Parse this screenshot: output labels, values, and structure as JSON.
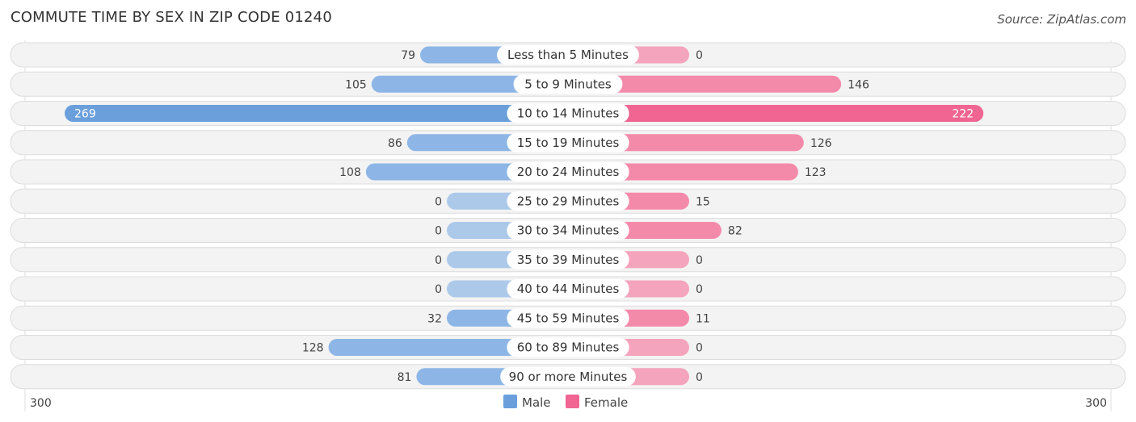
{
  "header": {
    "title": "COMMUTE TIME BY SEX IN ZIP CODE 01240",
    "source": "Source: ZipAtlas.com"
  },
  "chart_data": {
    "type": "bar",
    "orientation": "horizontal-diverging",
    "title": "COMMUTE TIME BY SEX IN ZIP CODE 01240",
    "categories": [
      "Less than 5 Minutes",
      "5 to 9 Minutes",
      "10 to 14 Minutes",
      "15 to 19 Minutes",
      "20 to 24 Minutes",
      "25 to 29 Minutes",
      "30 to 34 Minutes",
      "35 to 39 Minutes",
      "40 to 44 Minutes",
      "45 to 59 Minutes",
      "60 to 89 Minutes",
      "90 or more Minutes"
    ],
    "series": [
      {
        "name": "Male",
        "color": "#8db6e6",
        "highlight_color": "#6a9fdb",
        "values": [
          79,
          105,
          269,
          86,
          108,
          0,
          0,
          0,
          0,
          32,
          128,
          81
        ]
      },
      {
        "name": "Female",
        "color": "#f48aaa",
        "highlight_color": "#f06592",
        "values": [
          0,
          146,
          222,
          126,
          123,
          15,
          82,
          0,
          0,
          11,
          0,
          0
        ]
      }
    ],
    "highlight_index": 2,
    "axis": {
      "left_label": "300",
      "right_label": "300",
      "max": 300
    },
    "legend": {
      "position": "bottom-center",
      "items": [
        "Male",
        "Female"
      ]
    }
  }
}
